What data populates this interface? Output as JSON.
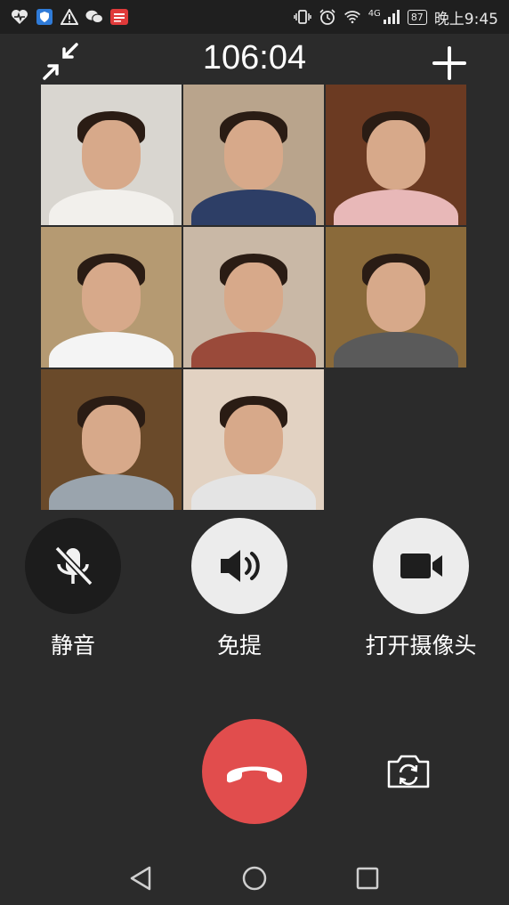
{
  "status_bar": {
    "network_type": "4G",
    "battery": "87",
    "time": "晚上9:45",
    "notification_icons": [
      "health-icon",
      "shield-app-icon",
      "warning-icon",
      "wechat-icon",
      "news-app-icon"
    ],
    "system_icons": [
      "vibrate-icon",
      "alarm-icon",
      "wifi-icon",
      "signal-icon"
    ]
  },
  "call": {
    "duration": "106:04"
  },
  "participants": [
    {
      "shirt": "#f2f0ec",
      "bg": "#d9d6d0"
    },
    {
      "shirt": "#2d3e66",
      "bg": "#b9a48c"
    },
    {
      "shirt": "#e8b8b8",
      "bg": "#6b3a22"
    },
    {
      "shirt": "#f4f4f4",
      "bg": "#b59a72"
    },
    {
      "shirt": "#9a4a3a",
      "bg": "#c9b8a6"
    },
    {
      "shirt": "#5a5a5a",
      "bg": "#8a6a3a"
    },
    {
      "shirt": "#9aa4ad",
      "bg": "#6a4a2a"
    },
    {
      "shirt": "#e4e4e4",
      "bg": "#e2d2c2"
    }
  ],
  "controls": {
    "mute_label": "静音",
    "speaker_label": "免提",
    "camera_label": "打开摄像头"
  },
  "colors": {
    "background": "#2b2b2b",
    "hangup": "#e14d4d",
    "mute_button": "#1c1c1c",
    "active_button": "#ececec"
  }
}
